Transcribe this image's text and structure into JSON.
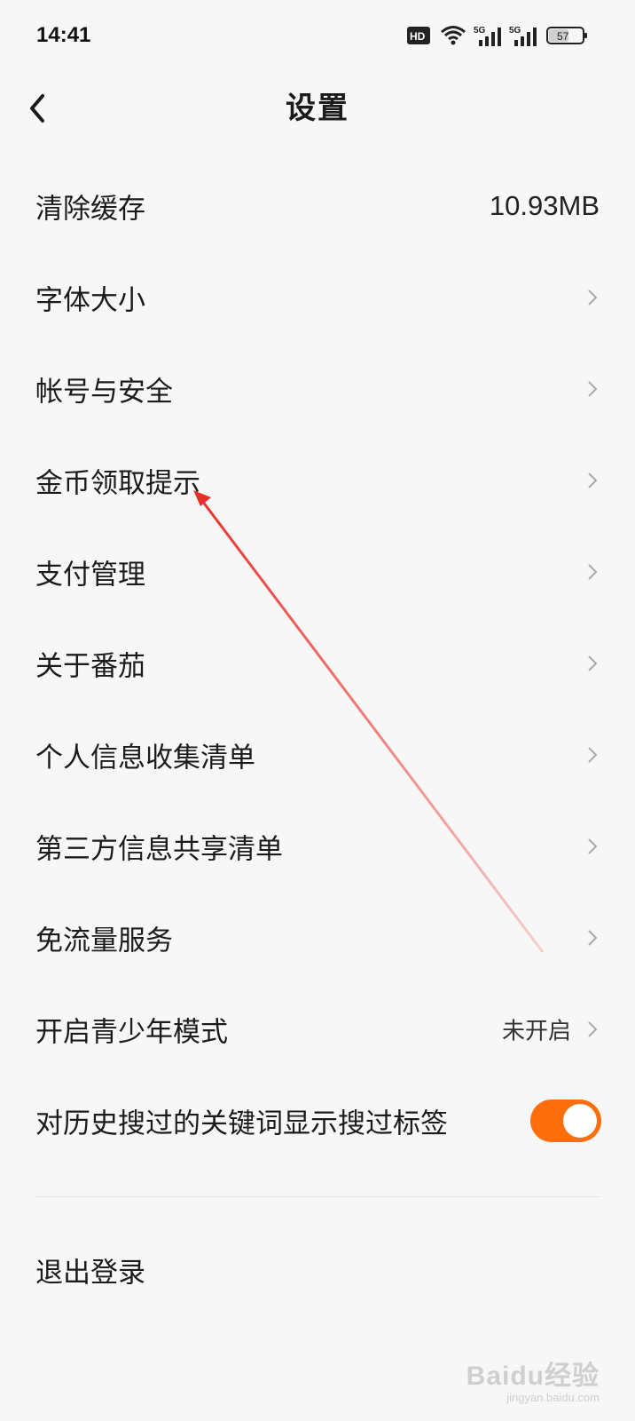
{
  "status_bar": {
    "time": "14:41",
    "icons": [
      "hd-voice-icon",
      "wifi-icon",
      "5g-signal-icon",
      "5g-signal-icon",
      "battery-icon"
    ],
    "network_label": "5G",
    "hd_label": "HD",
    "battery_level": "57"
  },
  "header": {
    "title": "设置",
    "back_icon": "chevron-left-icon"
  },
  "settings": {
    "items": [
      {
        "label": "清除缓存",
        "value": "10.93MB"
      },
      {
        "label": "字体大小"
      },
      {
        "label": "帐号与安全"
      },
      {
        "label": "金币领取提示"
      },
      {
        "label": "支付管理"
      },
      {
        "label": "关于番茄"
      },
      {
        "label": "个人信息收集清单"
      },
      {
        "label": "第三方信息共享清单"
      },
      {
        "label": "免流量服务"
      },
      {
        "label": "开启青少年模式",
        "status": "未开启"
      },
      {
        "label": "对历史搜过的关键词显示搜过标签",
        "toggle_on": true
      }
    ],
    "logout_label": "退出登录"
  },
  "colors": {
    "accent": "#ff6e0c",
    "annotation_arrow": "#e8302a",
    "background": "#f7f7f7"
  },
  "watermark": {
    "logo": "Baidu经验",
    "sub": "jingyan.baidu.com"
  }
}
